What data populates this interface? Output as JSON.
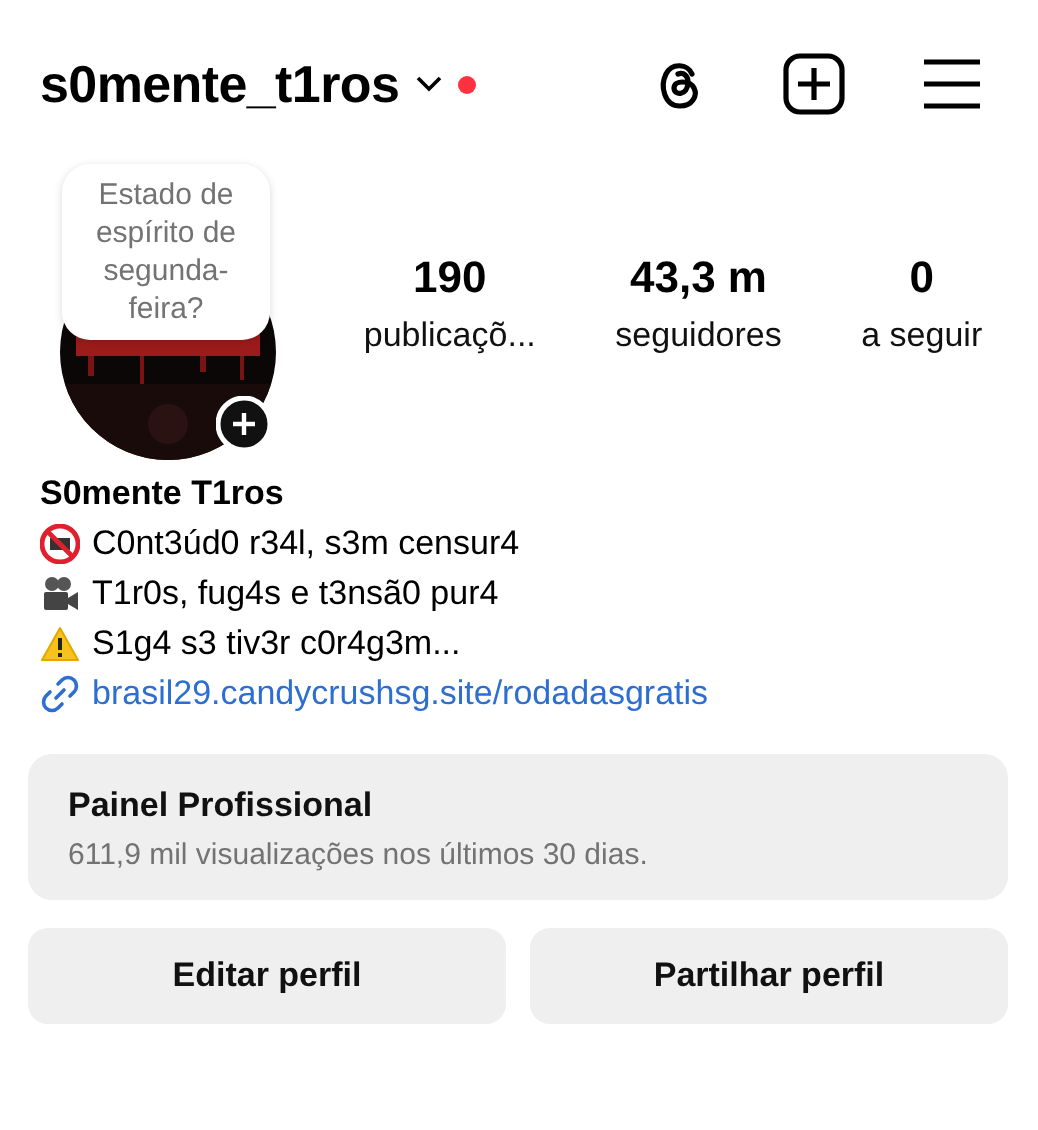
{
  "header": {
    "username": "s0mente_t1ros",
    "has_notification": true
  },
  "profile": {
    "note": "Estado de espírito de segunda-feira?",
    "stats": [
      {
        "value": "190",
        "label": "publicaçõ..."
      },
      {
        "value": "43,3 m",
        "label": "seguidores"
      },
      {
        "value": "0",
        "label": "a seguir"
      }
    ]
  },
  "bio": {
    "name": "S0mente T1ros",
    "lines": [
      {
        "kind": "adult",
        "text": "C0nt3úd0 r34l, s3m censur4"
      },
      {
        "kind": "camera",
        "text": "T1r0s, fug4s e t3nsã0 pur4"
      },
      {
        "kind": "warning",
        "text": "S1g4 s3 tiv3r c0r4g3m..."
      }
    ],
    "link": "brasil29.candycrushsg.site/rodadasgratis"
  },
  "dashboard": {
    "title": "Painel Profissional",
    "subtitle": "611,9 mil visualizações nos últimos 30 dias."
  },
  "buttons": [
    "Editar perfil",
    "Partilhar perfil"
  ]
}
